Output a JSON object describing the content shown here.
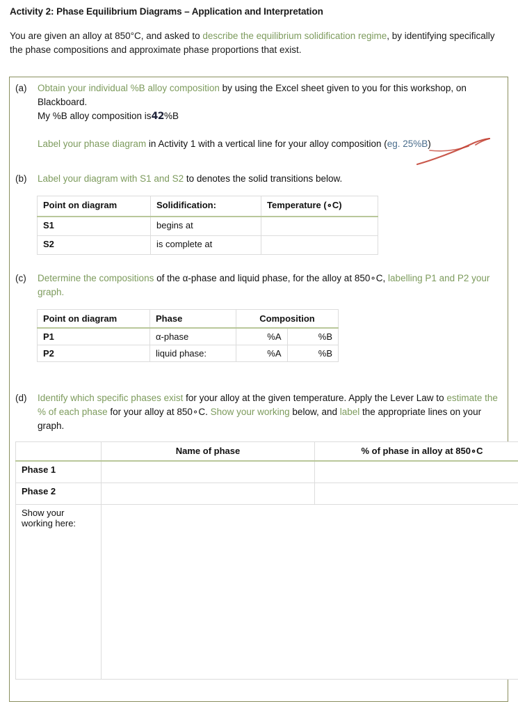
{
  "document": {
    "title": "Activity 2: Phase Equilibrium Diagrams – Application and Interpretation",
    "intro": {
      "part1": "You are given an alloy at 850°C, and asked to ",
      "highlight": "describe the equilibrium solidification regime",
      "part2": ", by identifying specifically the phase compositions and approximate phase proportions that exist."
    }
  },
  "questions": {
    "a": {
      "label": "(a)",
      "line1_green": "Obtain your individual %B alloy composition",
      "line1_black": " by using the Excel sheet given to you for this workshop, on Blackboard.",
      "line2_prefix": "My %B alloy composition is",
      "line2_handwritten": "42",
      "line2_suffix": "%B",
      "line3_green": "Label your phase diagram",
      "line3_black": " in Activity 1 with a vertical line for your alloy composition (",
      "line3_blue": "eg. 25%B",
      "line3_close": ")",
      "annotation": "red-strikethrough-swoosh"
    },
    "b": {
      "label": "(b)",
      "text_green": "Label your diagram with S1 and S2",
      "text_black": " to denotes the solid transitions below.",
      "table": {
        "headers": [
          "Point on diagram",
          "Solidification:",
          "Temperature (∘C)"
        ],
        "rows": [
          {
            "point": "S1",
            "solidification": "begins at",
            "temperature": ""
          },
          {
            "point": "S2",
            "solidification": "is complete at",
            "temperature": ""
          }
        ]
      }
    },
    "c": {
      "label": "(c)",
      "text_green1": "Determine the compositions",
      "text_black1": " of the α-phase and liquid phase, for the alloy at 850∘C,",
      "text_green2": " labelling P1 and P2 your graph.",
      "table": {
        "headers": [
          "Point on diagram",
          "Phase",
          "Composition"
        ],
        "rows": [
          {
            "point": "P1",
            "phase": "α-phase",
            "comp_a": "%A",
            "comp_b": "%B"
          },
          {
            "point": "P2",
            "phase": "liquid phase:",
            "comp_a": "%A",
            "comp_b": "%B"
          }
        ]
      }
    },
    "d": {
      "label": "(d)",
      "text_green1": "Identify which specific phases exist",
      "text_black1": " for your alloy at the given temperature. Apply the Lever Law to ",
      "text_green2": "estimate the % of each phase",
      "text_black2": " for your alloy at 850∘C. ",
      "text_green3": "Show your working",
      "text_black3": " below, and ",
      "text_green4": "label",
      "text_black4": " the appropriate lines on your graph.",
      "table": {
        "headers": [
          "",
          "Name of phase",
          "% of phase in alloy at 850∘C"
        ],
        "rows": [
          {
            "row_label": "Phase 1",
            "name_of_phase": "",
            "percent": ""
          },
          {
            "row_label": "Phase 2",
            "name_of_phase": "",
            "percent": ""
          }
        ],
        "working_label": "Show your working here:",
        "working_value": ""
      }
    }
  },
  "colors": {
    "green_text": "#7d9b5d",
    "blue_text": "#4a6d8c",
    "box_border": "#8a8f5e",
    "table_border": "#dcdcdc",
    "header_underline": "#b9c79a",
    "red_pen": "#c0392b"
  }
}
